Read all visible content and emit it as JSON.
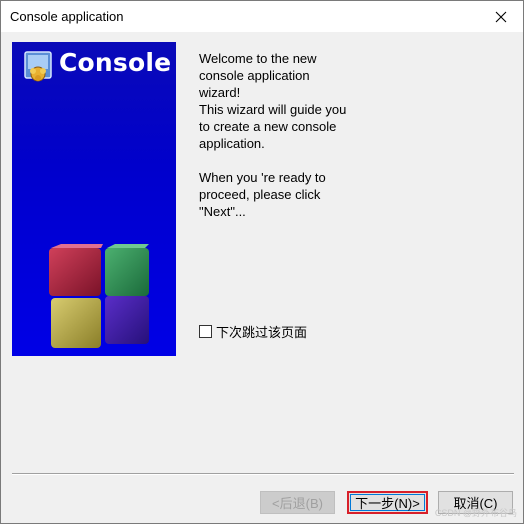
{
  "window": {
    "title": "Console application"
  },
  "banner": {
    "title": "Console"
  },
  "welcome": {
    "paragraph1": "Welcome to the new\nconsole application\nwizard!\nThis wizard will guide you\nto create a new console\napplication.",
    "paragraph2": "When you 're ready to\nproceed, please click\n\"Next\"..."
  },
  "skip": {
    "label": "下次跳过该页面",
    "checked": false
  },
  "buttons": {
    "back": "<后退(B)",
    "next": "下一步(N)>",
    "cancel": "取消(C)"
  },
  "watermark": "CSDN @野外布谷鸟",
  "colors": {
    "banner": "#0000e0",
    "highlight": "#d8202a"
  }
}
